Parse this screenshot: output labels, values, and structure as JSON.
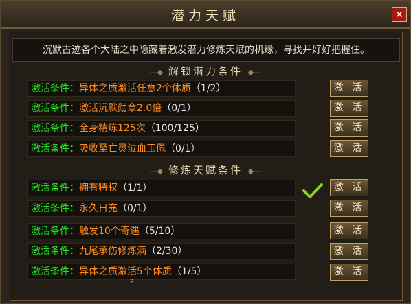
{
  "window": {
    "title": "潜力天赋",
    "close_icon": "close-icon"
  },
  "intro": "沉默古迹各个大陆之中隐藏着激发潜力修炼天赋的机缘，寻找并好好把握住。",
  "sections": [
    {
      "title": "解锁潜力条件",
      "rows": [
        {
          "label": "激活条件：",
          "condition": "异体之质激活任意2个体质",
          "progress": "（1/2）",
          "button": "激 活"
        },
        {
          "label": "激活条件：",
          "condition": "激活沉默勋章2.0倍",
          "progress": "（0/1）",
          "button": "激 活"
        },
        {
          "label": "激活条件：",
          "condition": "全身精炼125次",
          "progress": "（100/125）",
          "button": "激 活"
        },
        {
          "label": "激活条件：",
          "condition": "吸收至亡灵泣血玉佩",
          "progress": "（0/1）",
          "button": "激 活"
        }
      ]
    },
    {
      "title": "修炼天赋条件",
      "rows": [
        {
          "label": "激活条件：",
          "condition": "拥有特权",
          "progress": "（1/1）",
          "button": "激 活",
          "completed": true
        },
        {
          "label": "激活条件：",
          "condition": "永久日充",
          "progress": "（0/1）",
          "button": "激 活"
        },
        {
          "label": "激活条件：",
          "condition": "触发10个奇遇",
          "progress": "（5/10）",
          "button": "激 活"
        },
        {
          "label": "激活条件：",
          "condition": "九尾承伤修炼满",
          "progress": "（2/30）",
          "button": "激 活"
        },
        {
          "label": "激活条件：",
          "condition": "异体之质激活5个体质",
          "progress": "（1/5）",
          "button": "激 活"
        }
      ]
    }
  ],
  "stray_mark": "2",
  "colors": {
    "label": "#22e822",
    "condition": "#ff8a1e",
    "progress": "#e6e6e6",
    "check": "#8bd21e"
  }
}
